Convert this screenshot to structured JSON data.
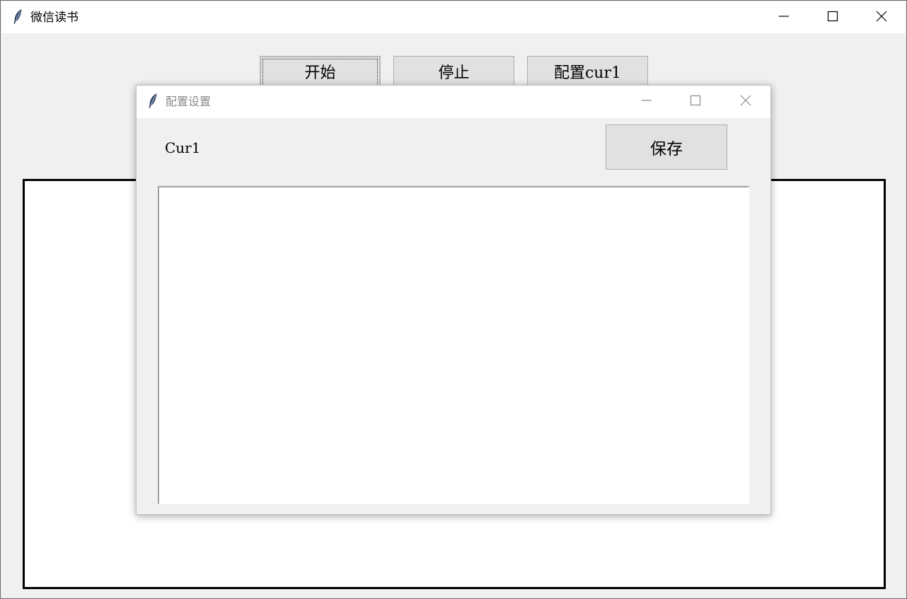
{
  "main_window": {
    "title": "微信读书",
    "icon": "feather-icon",
    "controls": [
      "minimize-icon",
      "maximize-icon",
      "close-icon"
    ]
  },
  "toolbar": {
    "start_label": "开始",
    "stop_label": "停止",
    "config_label": "配置cur1"
  },
  "dialog": {
    "title": "配置设置",
    "icon": "feather-icon",
    "field_label": "Cur1",
    "save_label": "保存",
    "text_value": ""
  }
}
